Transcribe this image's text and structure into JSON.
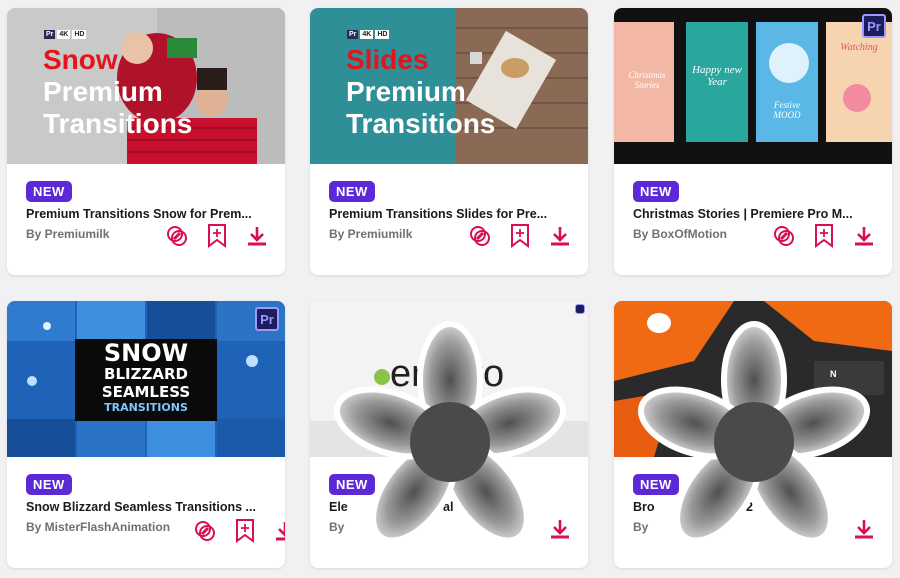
{
  "cards": [
    {
      "badge": "NEW",
      "title": "Premium Transitions Snow for Prem...",
      "author": "By Premiumilk",
      "thumb": {
        "line1": "Snow",
        "line2": "Premium",
        "line3": "Transitions",
        "tag1": "Pr",
        "tag2": "4K",
        "tag3": "HD"
      }
    },
    {
      "badge": "NEW",
      "title": "Premium Transitions Slides for Pre...",
      "author": "By Premiumilk",
      "thumb": {
        "line1": "Slides",
        "line2": "Premium",
        "line3": "Transitions",
        "tag1": "Pr",
        "tag2": "4K",
        "tag3": "HD"
      }
    },
    {
      "badge": "NEW",
      "title": "Christmas Stories | Premiere Pro M...",
      "author": "By BoxOfMotion",
      "thumb": {
        "pr": "Pr",
        "s1": "Christmas Stories",
        "s2": "Happy new Year",
        "s3": "Festive MOOD",
        "s4": "Watching"
      }
    },
    {
      "badge": "NEW",
      "title": "Snow Blizzard Seamless Transitions ...",
      "author": "By MisterFlashAnimation",
      "thumb": {
        "pr": "Pr",
        "w1": "SNOW",
        "w2": "BLIZZARD",
        "w3": "SEAMLESS",
        "w4": "TRANSITIONS"
      }
    },
    {
      "badge": "NEW",
      "title": "Ele",
      "title_end": "al",
      "author": "By",
      "thumb": {
        "logo": "envato"
      }
    },
    {
      "badge": "NEW",
      "title": "Bro",
      "title_end": "2",
      "author": "By",
      "thumb": {
        "label": "N"
      }
    }
  ],
  "colors": {
    "accent": "#d8104f",
    "badge": "#5b2ad6",
    "premiere": "#1d1d5e"
  },
  "icons": [
    "preview-icon",
    "bookmark-add-icon",
    "download-icon"
  ]
}
